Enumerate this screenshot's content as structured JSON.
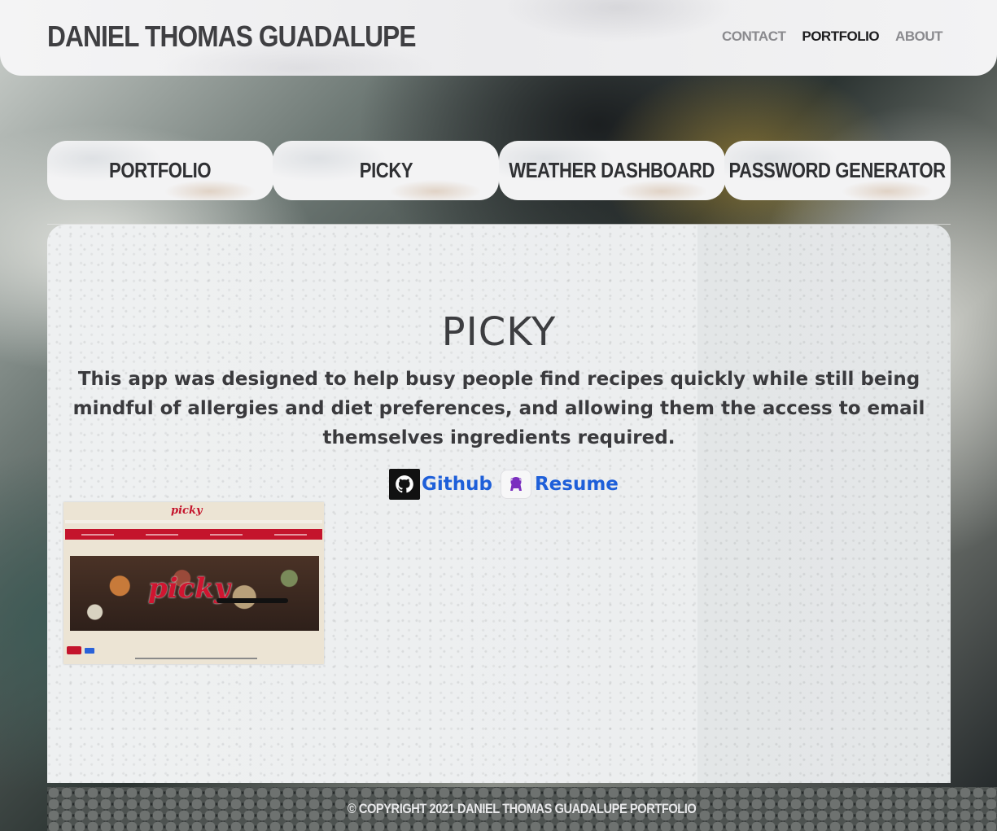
{
  "header": {
    "site_title": "DANIEL THOMAS GUADALUPE",
    "nav": [
      {
        "label": "CONTACT"
      },
      {
        "label": "PORTFOLIO"
      },
      {
        "label": "ABOUT"
      }
    ],
    "active_nav": "PORTFOLIO"
  },
  "tabs": [
    {
      "label": "PORTFOLIO"
    },
    {
      "label": "PICKY"
    },
    {
      "label": "WEATHER DASHBOARD"
    },
    {
      "label": "PASSWORD GENERATOR"
    }
  ],
  "project": {
    "title": "PICKY",
    "description": "This app was designed to help busy people find recipes quickly while still being mindful of allergies and diet preferences, and allowing them the access to email themselves ingredients required.",
    "links": {
      "github_label": "Github",
      "resume_label": "Resume"
    },
    "screenshot": {
      "logo_text": "picky",
      "hero_text": "picky",
      "accent_color": "#c4142c"
    }
  },
  "footer": {
    "text": "© COPYRIGHT 2021 DANIEL THOMAS GUADALUPE PORTFOLIO"
  },
  "colors": {
    "link": "#1e5fd9",
    "nav_active": "#1c1c1e",
    "nav_inactive": "#8a8a8e"
  },
  "icons": {
    "github": "github-octocat-icon",
    "resume": "github-purple-octocat-icon"
  }
}
